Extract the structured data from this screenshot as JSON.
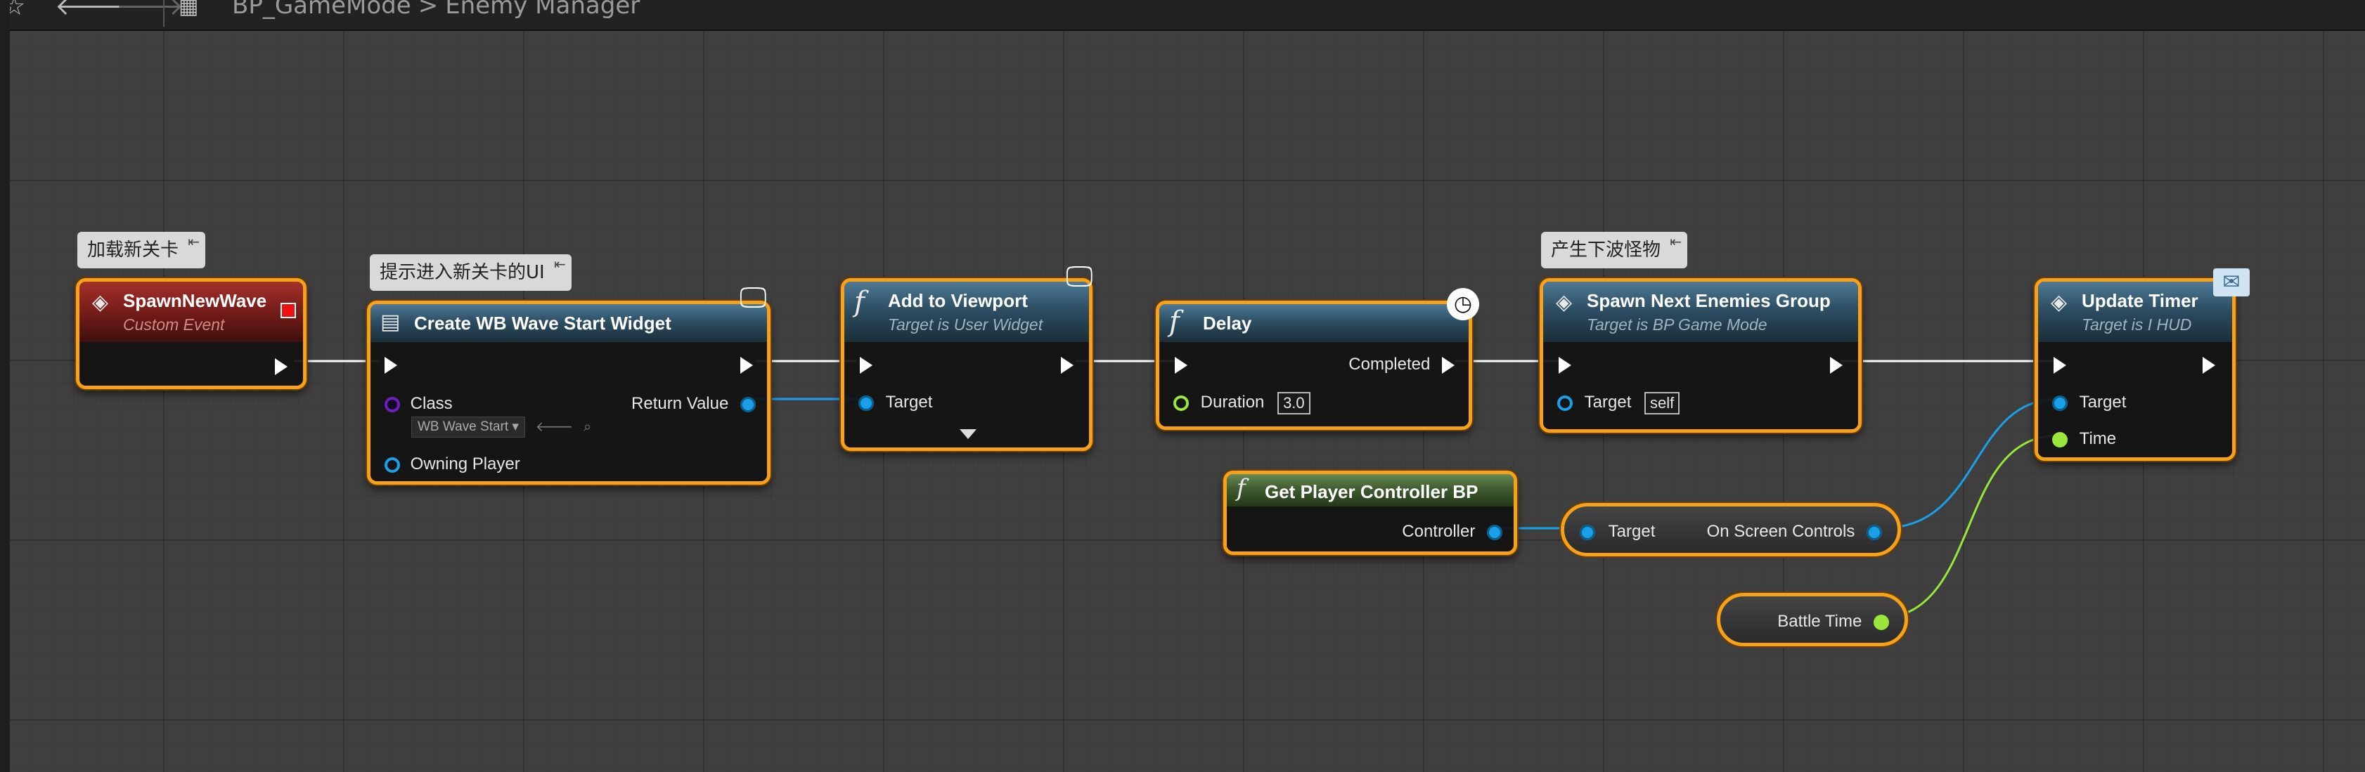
{
  "toolbar": {
    "breadcrumb": {
      "blueprint": "BP_GameMode",
      "separator": ">",
      "graph": "Enemy Manager"
    }
  },
  "comments": {
    "load_level": "加载新关卡",
    "show_ui": "提示进入新关卡的UI",
    "spawn_next": "产生下波怪物"
  },
  "nodes": {
    "spawn_new_wave": {
      "title": "SpawnNewWave",
      "subtitle": "Custom Event"
    },
    "create_widget": {
      "title": "Create WB Wave Start Widget",
      "class_label": "Class",
      "class_value": "WB Wave Start",
      "owning_player_label": "Owning Player",
      "return_label": "Return Value"
    },
    "add_to_viewport": {
      "title": "Add to Viewport",
      "subtitle": "Target is User Widget",
      "target_label": "Target"
    },
    "delay": {
      "title": "Delay",
      "completed_label": "Completed",
      "duration_label": "Duration",
      "duration_value": "3.0"
    },
    "spawn_enemies": {
      "title": "Spawn Next Enemies Group",
      "subtitle": "Target is BP Game Mode",
      "target_label": "Target",
      "target_value": "self"
    },
    "update_timer": {
      "title": "Update Timer",
      "subtitle": "Target is I HUD",
      "target_label": "Target",
      "time_label": "Time"
    },
    "get_player_controller": {
      "title": "Get Player Controller BP",
      "controller_label": "Controller"
    },
    "on_screen_controls": {
      "target_label": "Target",
      "output_label": "On Screen Controls"
    },
    "battle_time": {
      "label": "Battle Time"
    }
  },
  "colors": {
    "selection_outline": "#f5a11a",
    "exec_wire": "#ffffff",
    "object_wire": "#19a0e8",
    "float_wire": "#9be63a",
    "function_header": "#2d4e63",
    "event_header": "#7a1e1a",
    "pure_header": "#3f5c31"
  }
}
